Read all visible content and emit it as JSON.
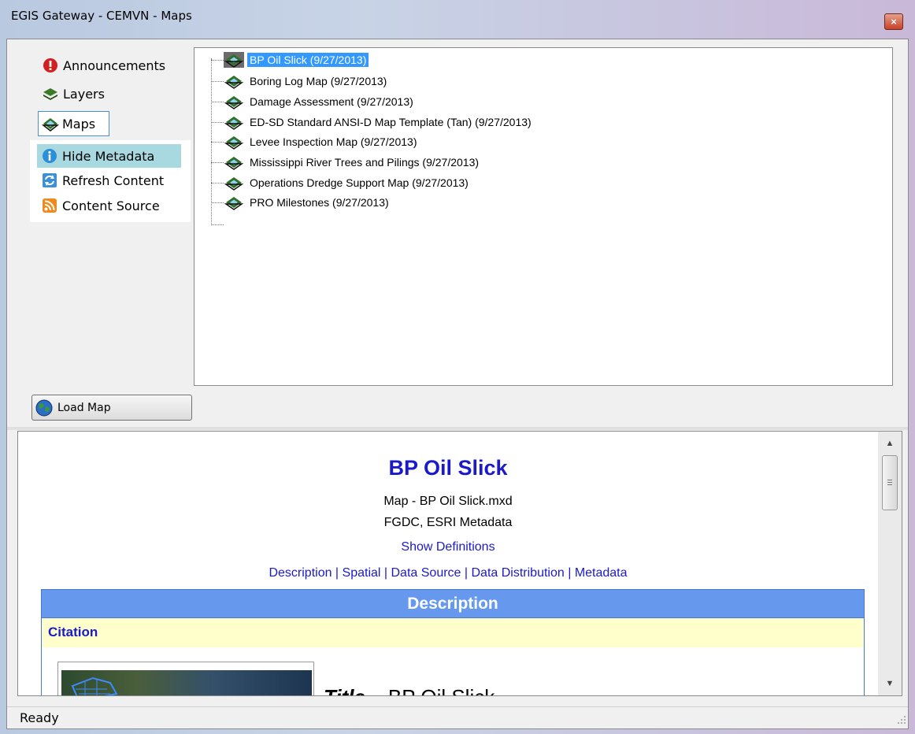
{
  "window": {
    "title": "EGIS Gateway - CEMVN - Maps",
    "close_glyph": "×"
  },
  "nav": {
    "items": [
      {
        "label": "Announcements",
        "icon": "exclamation-icon"
      },
      {
        "label": "Layers",
        "icon": "layers-icon"
      },
      {
        "label": "Maps",
        "icon": "map-icon",
        "selected": true
      }
    ],
    "actions": [
      {
        "label": "Hide Metadata",
        "icon": "info-icon",
        "highlighted": true
      },
      {
        "label": "Refresh Content",
        "icon": "refresh-icon"
      },
      {
        "label": "Content Source",
        "icon": "rss-icon"
      }
    ]
  },
  "tree": {
    "items": [
      {
        "label": "BP Oil Slick (9/27/2013)",
        "selected": true
      },
      {
        "label": "Boring Log Map (9/27/2013)"
      },
      {
        "label": "Damage Assessment (9/27/2013)"
      },
      {
        "label": "ED-SD Standard ANSI-D Map Template (Tan) (9/27/2013)"
      },
      {
        "label": "Levee Inspection Map (9/27/2013)"
      },
      {
        "label": "Mississippi River Trees and Pilings (9/27/2013)"
      },
      {
        "label": "Operations Dredge Support Map (9/27/2013)"
      },
      {
        "label": "PRO Milestones (9/27/2013)"
      }
    ]
  },
  "load_button": {
    "label": "Load Map",
    "icon": "globe-icon"
  },
  "metadata": {
    "title": "BP Oil Slick",
    "subtitle": "Map - BP Oil Slick.mxd",
    "standards": "FGDC, ESRI Metadata",
    "show_definitions": "Show Definitions",
    "links": [
      "Description",
      "Spatial",
      "Data Source",
      "Data Distribution",
      "Metadata"
    ],
    "link_separator": " | ",
    "section_header": "Description",
    "subsection_header": "Citation",
    "title_field_label": "Title",
    "title_field_value": "BP Oil Slick"
  },
  "status": {
    "text": "Ready"
  },
  "colors": {
    "link": "#1a1acc",
    "section_header_bg": "#6699ee",
    "subsection_bg": "#ffffcc",
    "selection_bg": "#3399ff",
    "nav_highlight": "#a8d8e0"
  }
}
